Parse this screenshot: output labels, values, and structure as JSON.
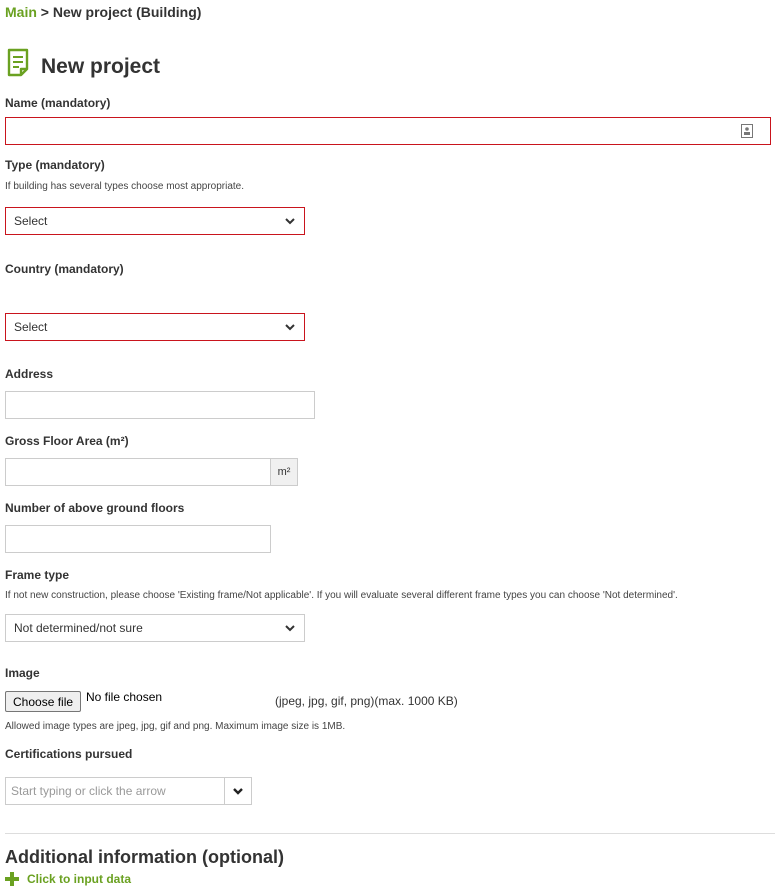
{
  "breadcrumb": {
    "home": "Main",
    "separator": ">",
    "current": "New project (Building)"
  },
  "page": {
    "title": "New project",
    "title_icon": "document-icon"
  },
  "form": {
    "name": {
      "label": "Name (mandatory)",
      "value": "",
      "icon": "contact-card-icon"
    },
    "type": {
      "label": "Type (mandatory)",
      "help": "If building has several types choose most appropriate.",
      "selected": "Select"
    },
    "country": {
      "label": "Country (mandatory)",
      "selected": "Select"
    },
    "address": {
      "label": "Address",
      "value": ""
    },
    "gross_floor_area": {
      "label": "Gross Floor Area (m²)",
      "value": "",
      "unit": "m²"
    },
    "floors": {
      "label": "Number of above ground floors",
      "value": ""
    },
    "frame_type": {
      "label": "Frame type",
      "help": "If not new construction, please choose 'Existing frame/Not applicable'. If you will evaluate several different frame types you can choose 'Not determined'.",
      "selected": "Not determined/not sure"
    },
    "image": {
      "label": "Image",
      "button": "Choose file",
      "status": "No file chosen",
      "formats": "(jpeg, jpg, gif, png)(max. 1000 KB)",
      "help": "Allowed image types are jpeg, jpg, gif and png. Maximum image size is 1MB."
    },
    "certifications": {
      "label": "Certifications pursued",
      "placeholder": "Start typing or click the arrow"
    }
  },
  "additional": {
    "title": "Additional information (optional)",
    "link": "Click to input data"
  },
  "colors": {
    "accent_green": "#6aa121",
    "error_red": "#c9141d",
    "border_gray": "#cccccc"
  }
}
